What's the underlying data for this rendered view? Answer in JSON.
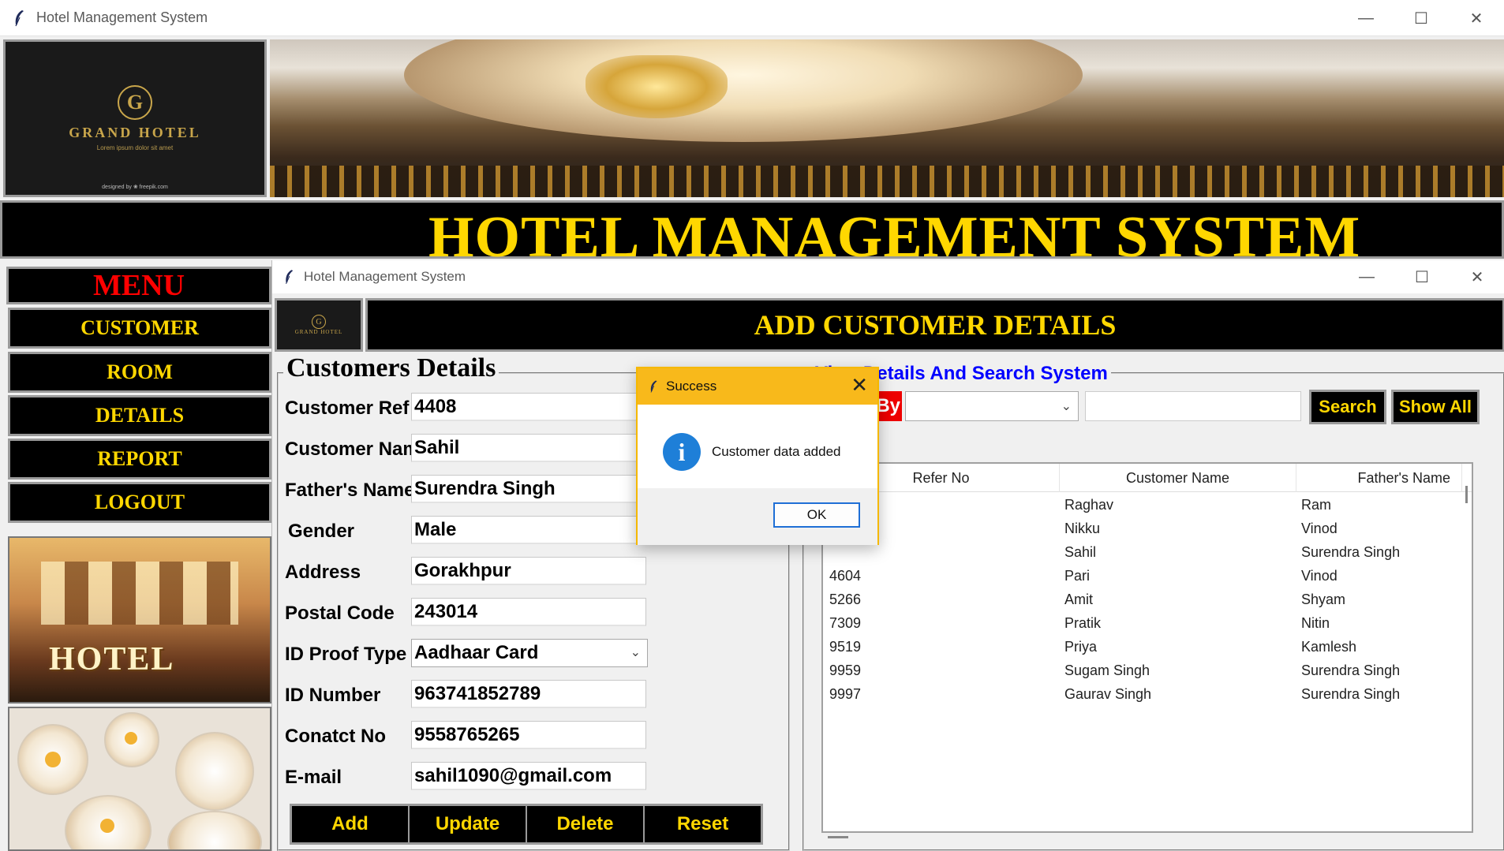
{
  "window": {
    "title": "Hotel Management System",
    "controls": [
      "—",
      "☐",
      "✕"
    ]
  },
  "logo": {
    "letter": "G",
    "name": "GRAND HOTEL",
    "tagline": "Lorem ipsum dolor sit amet",
    "credit": "designed by ❀ freepik.com"
  },
  "headline": "HOTEL MANAGEMENT SYSTEM",
  "menu": {
    "title": "MENU",
    "items": [
      "CUSTOMER",
      "ROOM",
      "DETAILS",
      "REPORT",
      "LOGOUT"
    ],
    "image_text": "HOTEL"
  },
  "child_window": {
    "title": "Hotel Management System",
    "heading": "ADD CUSTOMER DETAILS",
    "logo_letter": "G",
    "logo_name": "GRAND HOTEL"
  },
  "form": {
    "legend": "Customers Details",
    "fields": [
      {
        "label": "Customer Ref",
        "value": "4408"
      },
      {
        "label": "Customer Name",
        "value": "Sahil"
      },
      {
        "label": "Father's Name",
        "value": "Surendra Singh"
      },
      {
        "label": "Gender",
        "value": "Male"
      },
      {
        "label": "Address",
        "value": "Gorakhpur"
      },
      {
        "label": "Postal Code",
        "value": "243014"
      },
      {
        "label": "ID Proof Type",
        "value": "Aadhaar Card"
      },
      {
        "label": "ID Number",
        "value": "963741852789"
      },
      {
        "label": "Conatct No",
        "value": "9558765265"
      },
      {
        "label": "E-mail",
        "value": "sahil1090@gmail.com"
      }
    ],
    "buttons": [
      "Add",
      "Update",
      "Delete",
      "Reset"
    ]
  },
  "search": {
    "legend": "View Details And Search System",
    "by_label": "By",
    "search_button": "Search",
    "show_all_button": "Show All"
  },
  "table": {
    "columns": [
      "Refer No",
      "Customer Name",
      "Father's Name"
    ],
    "rows": [
      [
        "",
        "Raghav",
        "Ram"
      ],
      [
        "",
        "Nikku",
        "Vinod"
      ],
      [
        "",
        "Sahil",
        "Surendra Singh"
      ],
      [
        "4604",
        "Pari",
        "Vinod"
      ],
      [
        "5266",
        "Amit",
        "Shyam"
      ],
      [
        "7309",
        "Pratik",
        "Nitin"
      ],
      [
        "9519",
        "Priya",
        "Kamlesh"
      ],
      [
        "9959",
        "Sugam Singh",
        "Surendra Singh"
      ],
      [
        "9997",
        "Gaurav Singh",
        "Surendra Singh"
      ]
    ]
  },
  "dialog": {
    "title": "Success",
    "message": "Customer data added",
    "ok": "OK",
    "close": "✕",
    "icon": "i"
  }
}
